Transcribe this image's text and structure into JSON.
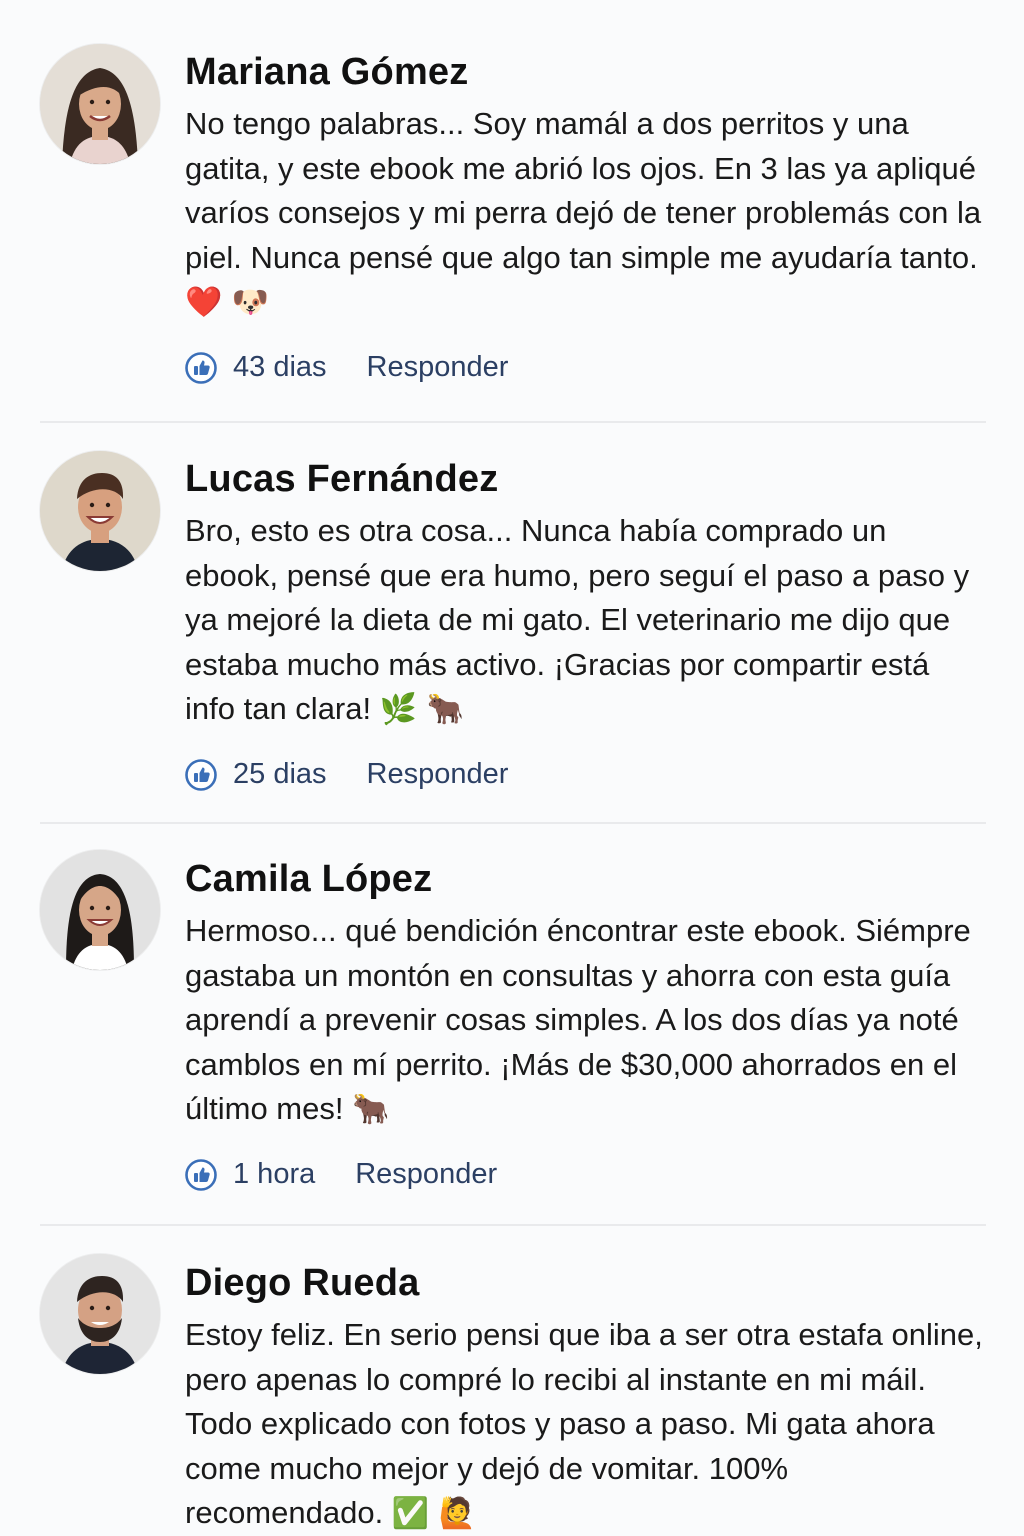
{
  "comments": [
    {
      "name": "Mariana Gómez",
      "text": "No tengo palabras... Soy mamál a dos perritos y una gatita, y este ebook me abrió los ojos. En 3 las ya apliqué varíos consejos y mi perra dejó de tener problemás con la piel. Nunca pensé que algo tan simple me ayudaría tanto.",
      "emoji": "❤️ 🐶",
      "time": "43 dias",
      "reply_label": "Responder",
      "avatar_colors": {
        "bg": "#e4ded6",
        "skin": "#d9a98a",
        "hair": "#3a2a22",
        "shirt": "#e9d3cf"
      }
    },
    {
      "name": "Lucas Fernández",
      "text": "Bro, esto es otra cosa... Nunca había comprado un ebook, pensé que era humo, pero seguí el paso a paso y ya mejoré la dieta de mi gato. El veterinario me dijo que estaba mucho más activo. ¡Gracias por compartir está info tan clara!",
      "emoji": "🌿 🐂",
      "time": "25 dias",
      "reply_label": "Responder",
      "avatar_colors": {
        "bg": "#ded8cb",
        "skin": "#d7a07f",
        "hair": "#4a2f22",
        "shirt": "#1d2533"
      }
    },
    {
      "name": "Camila López",
      "text": "Hermoso... qué bendición éncontrar este ebook. Siémpre gastaba un montón en consultas y ahorra con esta guía aprendí a prevenir cosas simples. A los dos días ya noté camblos en mí perrito. ¡Más de $30,000 ahorrados en el último mes!",
      "emoji": "🐂",
      "time": "1 hora",
      "reply_label": "Responder",
      "avatar_colors": {
        "bg": "#e2e2e2",
        "skin": "#d6a688",
        "hair": "#1e1a18",
        "shirt": "#ffffff"
      }
    },
    {
      "name": "Diego Rueda",
      "text": "Estoy feliz. En serio pensi que iba a ser otra estafa online, pero apenas lo compré lo recibi al instante en mi máil. Todo explicado con fotos y paso a paso. Mi gata ahora come mucho mejor y dejó de vomitar. 100% recomendado.",
      "emoji": "✅ 🙋",
      "time": "",
      "reply_label": "",
      "avatar_colors": {
        "bg": "#e4e4e4",
        "skin": "#d4a184",
        "hair": "#2e2420",
        "shirt": "#1e2535"
      }
    }
  ]
}
